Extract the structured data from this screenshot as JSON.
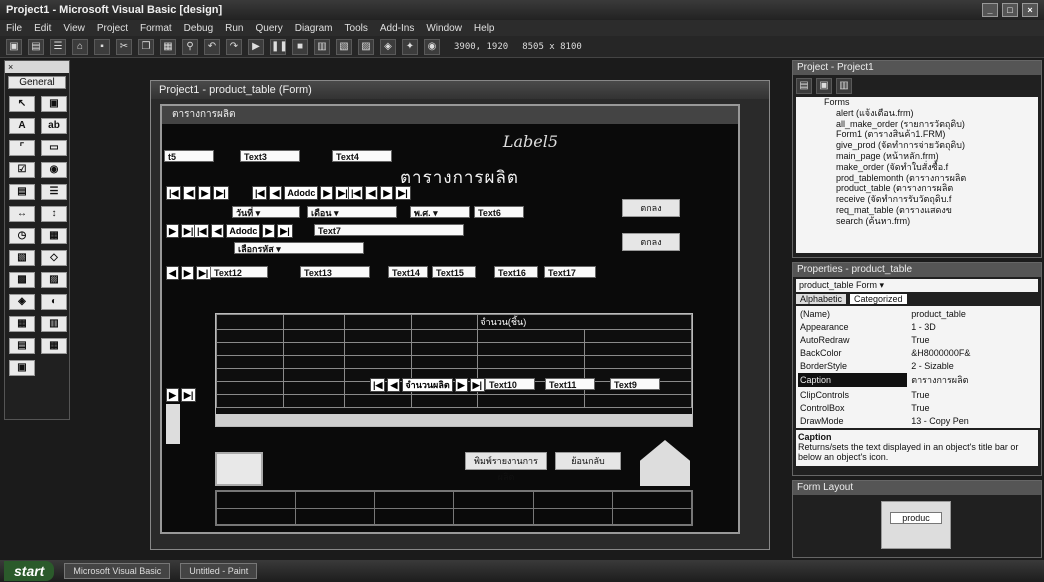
{
  "window": {
    "title": "Project1 - Microsoft Visual Basic [design]"
  },
  "menu": [
    "File",
    "Edit",
    "View",
    "Project",
    "Format",
    "Debug",
    "Run",
    "Query",
    "Diagram",
    "Tools",
    "Add-Ins",
    "Window",
    "Help"
  ],
  "toolbar": {
    "position": "3900, 1920",
    "size": "8505 x 8100"
  },
  "toolbox": {
    "header": "General"
  },
  "design_window": {
    "title": "Project1 - product_table (Form)"
  },
  "form": {
    "caption": "ตารางการผลิต",
    "heading": "ตารางการผลิต",
    "signature": "Label5",
    "textboxes": {
      "t5": "t5",
      "t3": "Text3",
      "t4": "Text4",
      "t6": "Text6",
      "t7": "Text7",
      "t12": "Text12",
      "t13": "Text13",
      "t14": "Text14",
      "t15": "Text15",
      "t16": "Text16",
      "t17": "Text17",
      "t10": "Text10",
      "t11": "Text11",
      "t9": "Text9"
    },
    "combos": {
      "c1": "วันที่",
      "c2": "เดือน",
      "c3": "พ.ศ.",
      "c4": "เลือกรหัส"
    },
    "adodc": {
      "adodc1": "Adodc",
      "adodc2": "จำนวนผลิต"
    },
    "grid_header": "จำนวน(ชิ้น)",
    "buttons": {
      "b1": "ตกลง",
      "b2": "ตกลง",
      "b3": "พิมพ์รายงานการผลิต",
      "b4": "ย้อนกลับ"
    }
  },
  "project": {
    "title": "Project - Project1",
    "forms_label": "Forms",
    "items": [
      "alert (แจ้งเตือน.frm)",
      "all_make_order (รายการวัตถุดิบ)",
      "Form1 (ตารางสินค้า1.FRM)",
      "give_prod (จัดทำการจ่ายวัตถุดิบ)",
      "main_page (หน้าหลัก.frm)",
      "make_order (จัดทำใบสั่งซื้อ.f",
      "prod_tablemonth (ตารางการผลิต",
      "product_table (ตารางการผลิต",
      "receive (จัดทำการรับวัตถุดิบ.f",
      "req_mat_table (ตารางแสดงข",
      "search (ค้นหา.frm)"
    ]
  },
  "properties": {
    "title": "Properties - product_table",
    "object": "product_table Form",
    "tab_alpha": "Alphabetic",
    "tab_cat": "Categorized",
    "rows": [
      [
        "(Name)",
        "product_table"
      ],
      [
        "Appearance",
        "1 - 3D"
      ],
      [
        "AutoRedraw",
        "True"
      ],
      [
        "BackColor",
        "&H8000000F&"
      ],
      [
        "BorderStyle",
        "2 - Sizable"
      ],
      [
        "Caption",
        "ตารางการผลิต"
      ],
      [
        "ClipControls",
        "True"
      ],
      [
        "ControlBox",
        "True"
      ],
      [
        "DrawMode",
        "13 - Copy Pen"
      ]
    ],
    "desc_title": "Caption",
    "desc_text": "Returns/sets the text displayed in an object's title bar or below an object's icon."
  },
  "layout_window": {
    "title": "Form Layout",
    "label": "produc"
  },
  "taskbar": {
    "start": "start",
    "task1": "Microsoft Visual Basic",
    "task2": "Untitled - Paint"
  },
  "colors": {
    "background": "#1b1b1b",
    "form": "#0a0a0a"
  }
}
